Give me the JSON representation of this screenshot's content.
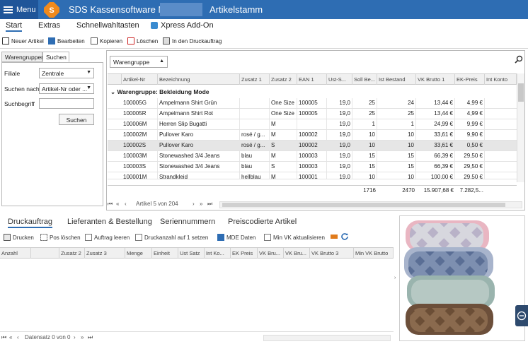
{
  "titlebar": {
    "menu_label": "Menu",
    "app_title": "SDS Kassensoftware Neo",
    "module_title": "Artikelstamm",
    "bg_color": "#2e6db3"
  },
  "ribbon": {
    "tabs": [
      "Start",
      "Extras",
      "Schnellwahltasten",
      "Xpress Add-On"
    ],
    "buttons": [
      "Neuer Artikel",
      "Bearbeiten",
      "Kopieren",
      "Löschen",
      "In den Druckauftrag"
    ]
  },
  "leftpanel": {
    "tabs": [
      "Warengruppen",
      "Suchen"
    ],
    "filiale_label": "Filiale",
    "filiale_value": "Zentrale",
    "suchen_nach_label": "Suchen nach",
    "suchen_nach_value": "Artikel-Nr oder ...",
    "suchbegriff_label": "Suchbegriff",
    "suchbegriff_value": "",
    "search_button": "Suchen"
  },
  "grid": {
    "group_by": "Warengruppe",
    "group_title": "Warengruppe: Bekleidung Mode",
    "columns": [
      "Artikel-Nr",
      "Bezeichnung",
      "Zusatz 1",
      "Zusatz 2",
      "EAN 1",
      "Ust-S...",
      "Soll Be...",
      "Ist Bestand",
      "VK Brutto 1",
      "EK-Preis",
      "Int Konto"
    ],
    "rows": [
      {
        "nr": "100005G",
        "bez": "Ampelmann Shirt Grün",
        "z1": "",
        "z2": "One Size",
        "ean": "100005",
        "ust": "19,0",
        "soll": "25",
        "ist": "24",
        "vk": "13,44 €",
        "ek": "4,99 €"
      },
      {
        "nr": "100005R",
        "bez": "Ampelmann Shirt Rot",
        "z1": "",
        "z2": "One Size",
        "ean": "100005",
        "ust": "19,0",
        "soll": "25",
        "ist": "25",
        "vk": "13,44 €",
        "ek": "4,99 €"
      },
      {
        "nr": "100006M",
        "bez": "Herren Slip Bugatti",
        "z1": "",
        "z2": "M",
        "ean": "",
        "ust": "19,0",
        "soll": "1",
        "ist": "1",
        "vk": "24,99 €",
        "ek": "9,99 €"
      },
      {
        "nr": "100002M",
        "bez": "Pullover Karo",
        "z1": "rosé / g...",
        "z2": "M",
        "ean": "100002",
        "ust": "19,0",
        "soll": "10",
        "ist": "10",
        "vk": "33,61 €",
        "ek": "9,90 €"
      },
      {
        "nr": "100002S",
        "bez": "Pullover Karo",
        "z1": "rosé / g...",
        "z2": "S",
        "ean": "100002",
        "ust": "19,0",
        "soll": "10",
        "ist": "10",
        "vk": "33,61 €",
        "ek": "0,50 €"
      },
      {
        "nr": "100003M",
        "bez": "Stonewashed 3/4 Jeans",
        "z1": "blau",
        "z2": "M",
        "ean": "100003",
        "ust": "19,0",
        "soll": "15",
        "ist": "15",
        "vk": "66,39 €",
        "ek": "29,50 €"
      },
      {
        "nr": "100003S",
        "bez": "Stonewashed 3/4 Jeans",
        "z1": "blau",
        "z2": "S",
        "ean": "100003",
        "ust": "19,0",
        "soll": "15",
        "ist": "15",
        "vk": "66,39 €",
        "ek": "29,50 €"
      },
      {
        "nr": "100001M",
        "bez": "Strandkleid",
        "z1": "hellblau",
        "z2": "M",
        "ean": "100001",
        "ust": "19,0",
        "soll": "10",
        "ist": "10",
        "vk": "100,00 €",
        "ek": "29,50 €"
      }
    ],
    "selected_row": 4,
    "sum_soll": "1716",
    "sum_ist": "2470",
    "sum_vk": "15.907,68 €",
    "sum_ek": "7.282,5...",
    "nav_text": "Artikel 5 von 204"
  },
  "bottom": {
    "tabs": [
      "Druckauftrag",
      "Lieferanten & Bestellung",
      "Seriennummern",
      "Preiscodierte Artikel"
    ],
    "buttons": [
      "Drucken",
      "Pos löschen",
      "Auftrag leeren",
      "Druckanzahl auf 1 setzen",
      "MDE Daten",
      "Min VK aktualisieren"
    ],
    "columns": [
      "Anzahl",
      "Zusatz 2",
      "Zusatz 3",
      "Menge",
      "Einheit",
      "Ust Satz",
      "Int Ko...",
      "EK Preis",
      "VK Bru...",
      "VK Bru...",
      "VK Brutto 3",
      "Min VK Brutto"
    ],
    "nav_text": "Datensatz 0 von 0"
  },
  "icons": [
    "menu-icon",
    "logo-icon",
    "new-icon",
    "edit-icon",
    "copy-icon",
    "delete-icon",
    "print-queue-icon",
    "search-icon",
    "print-icon",
    "refresh-icon"
  ]
}
